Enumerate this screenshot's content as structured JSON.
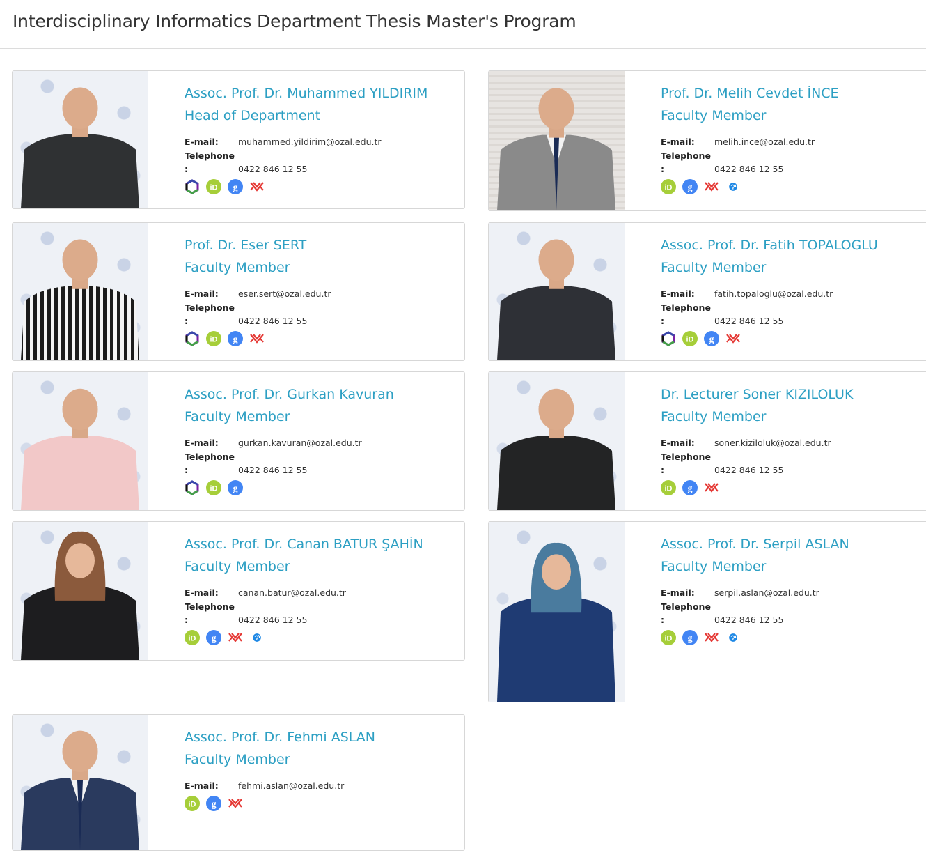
{
  "page": {
    "title": "Interdisciplinary Informatics Department Thesis Master's Program"
  },
  "labels": {
    "email": "E-mail:",
    "telephone": "Telephone",
    "colon": ":"
  },
  "colors": {
    "name": "#2c9fc3",
    "orcid": "#a6ce39",
    "scholar": "#4285f4",
    "yok": "#e53935",
    "web": "#1e88e5"
  },
  "faculty": [
    {
      "name": "Assoc. Prof. Dr. Muhammed YILDIRIM",
      "role": "Head of Department",
      "email": "muhammed.yildirim@ozal.edu.tr",
      "phone": "0422 846 12 55",
      "icons": [
        "publons-icon",
        "orcid-icon",
        "google-scholar-icon",
        "yoksis-icon"
      ]
    },
    {
      "name": "Prof. Dr. Melih Cevdet İNCE",
      "role": "Faculty Member",
      "email": "melih.ince@ozal.edu.tr",
      "phone": "0422 846 12 55",
      "icons": [
        "orcid-icon",
        "google-scholar-icon",
        "yoksis-icon",
        "website-icon"
      ]
    },
    {
      "name": "Prof. Dr. Eser SERT",
      "role": "Faculty Member",
      "email": "eser.sert@ozal.edu.tr",
      "phone": "0422 846 12 55",
      "icons": [
        "publons-icon",
        "orcid-icon",
        "google-scholar-icon",
        "yoksis-icon"
      ]
    },
    {
      "name": "Assoc. Prof. Dr. Fatih TOPALOGLU",
      "role": "Faculty Member",
      "email": "fatih.topaloglu@ozal.edu.tr",
      "phone": "0422 846 12 55",
      "icons": [
        "publons-icon",
        "orcid-icon",
        "google-scholar-icon",
        "yoksis-icon"
      ]
    },
    {
      "name": "Assoc. Prof. Dr. Gurkan Kavuran",
      "role": "Faculty Member",
      "email": "gurkan.kavuran@ozal.edu.tr",
      "phone": "0422 846 12 55",
      "icons": [
        "publons-icon",
        "orcid-icon",
        "google-scholar-icon"
      ]
    },
    {
      "name": "Dr. Lecturer Soner KIZILOLUK",
      "role": "Faculty Member",
      "email": "soner.kiziloluk@ozal.edu.tr",
      "phone": "0422 846 12 55",
      "icons": [
        "orcid-icon",
        "google-scholar-icon",
        "yoksis-icon"
      ]
    },
    {
      "name": "Assoc. Prof. Dr. Canan BATUR ŞAHİN",
      "role": "Faculty Member",
      "email": "canan.batur@ozal.edu.tr",
      "phone": "0422 846 12 55",
      "icons": [
        "orcid-icon",
        "google-scholar-icon",
        "yoksis-icon",
        "website-icon"
      ]
    },
    {
      "name": "Assoc. Prof. Dr. Serpil ASLAN",
      "role": "Faculty Member",
      "email": "serpil.aslan@ozal.edu.tr",
      "phone": "0422 846 12 55",
      "icons": [
        "orcid-icon",
        "google-scholar-icon",
        "yoksis-icon",
        "website-icon"
      ]
    },
    {
      "name": "Assoc. Prof. Dr. Fehmi ASLAN",
      "role": "Faculty Member",
      "email": "fehmi.aslan@ozal.edu.tr",
      "phone": "",
      "icons": [
        "orcid-icon",
        "google-scholar-icon",
        "yoksis-icon"
      ]
    }
  ]
}
